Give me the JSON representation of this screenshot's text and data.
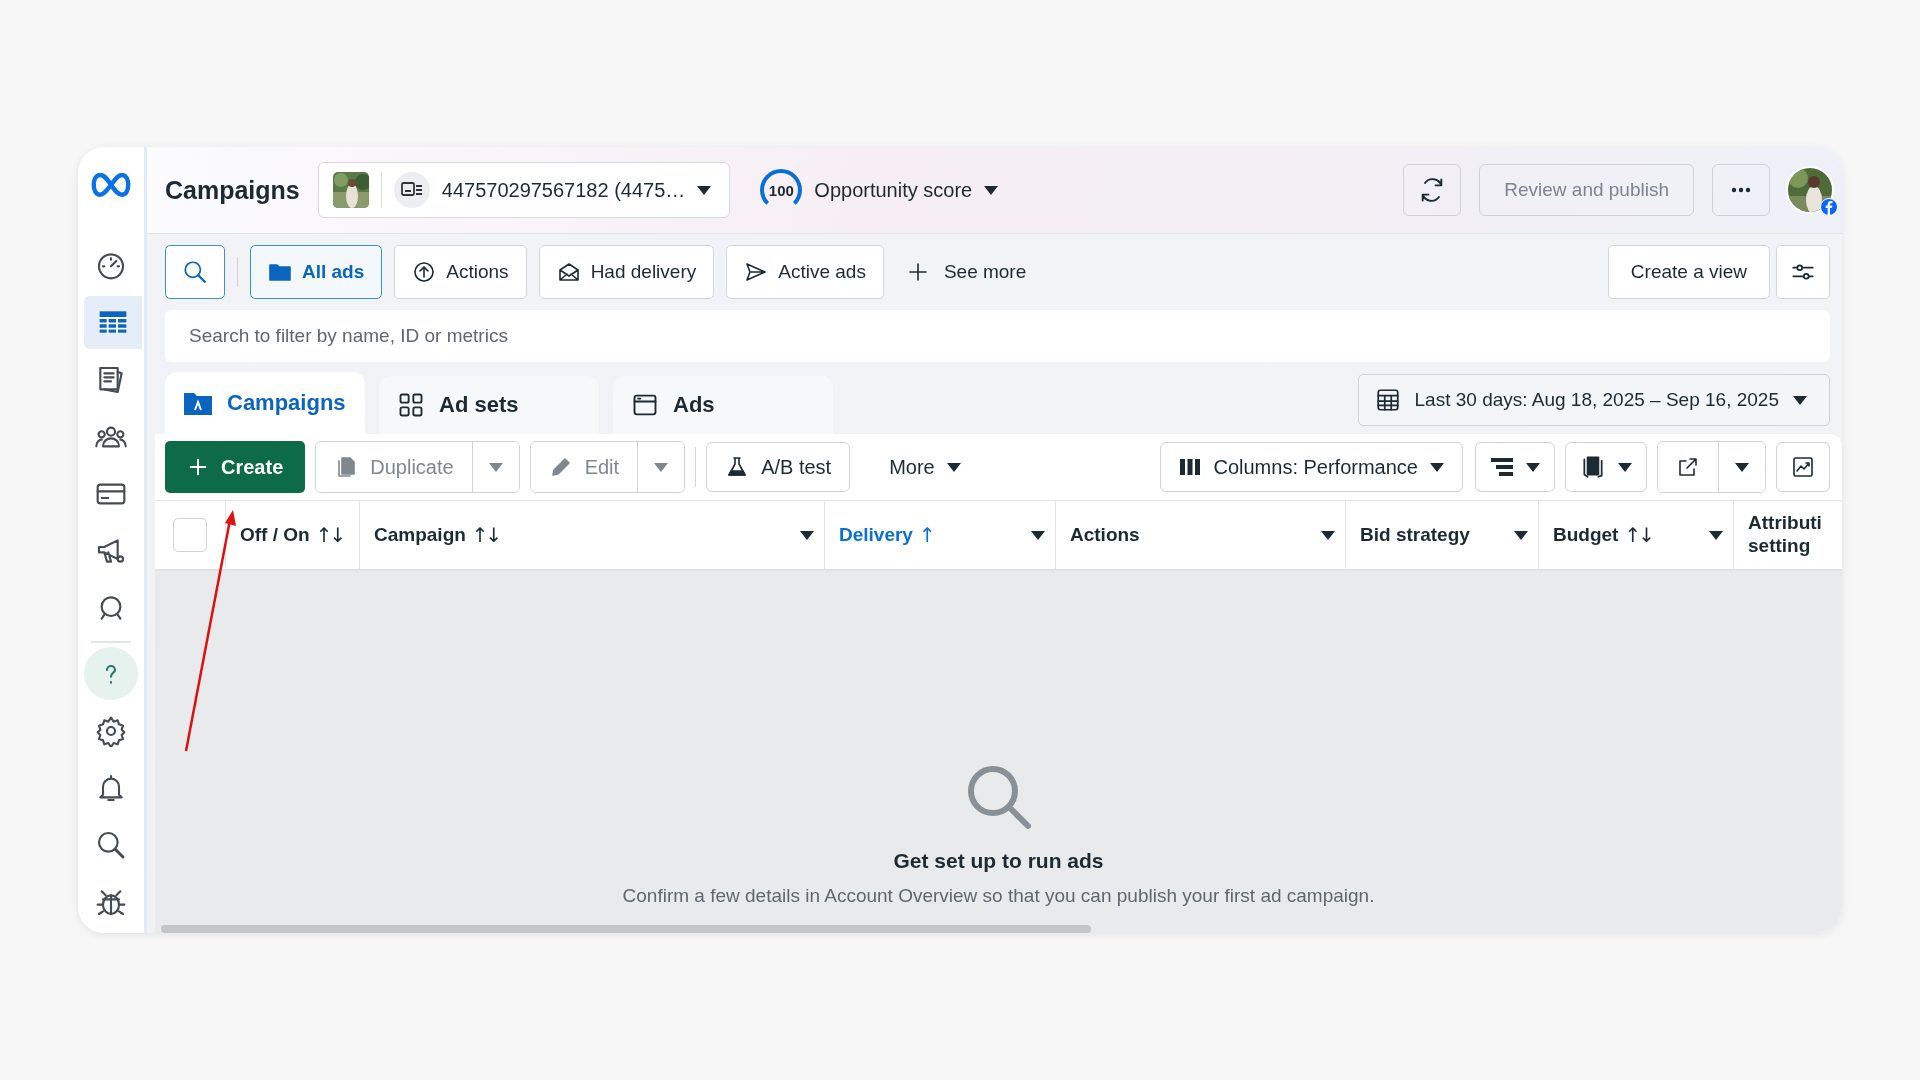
{
  "sidebar": {
    "items": [
      {
        "kind": "gauge",
        "selected": false
      },
      {
        "kind": "table",
        "selected": true
      },
      {
        "kind": "pages",
        "selected": false
      },
      {
        "kind": "people",
        "selected": false
      },
      {
        "kind": "card",
        "selected": false
      },
      {
        "kind": "megaphone",
        "selected": false
      },
      {
        "kind": "chat",
        "selected": false
      },
      {
        "kind": "help",
        "selected": false
      },
      {
        "kind": "gear",
        "selected": false
      },
      {
        "kind": "bell",
        "selected": false
      },
      {
        "kind": "search",
        "selected": false
      },
      {
        "kind": "bug",
        "selected": false
      }
    ]
  },
  "header": {
    "title": "Campaigns",
    "account": "447570297567182 (4475…",
    "score": "100",
    "score_label": "Opportunity score",
    "publish": {
      "label": "Review and publish",
      "disabled": true
    }
  },
  "filters": {
    "chips": [
      {
        "label": "All ads",
        "kind": "folder",
        "selected": true
      },
      {
        "label": "Actions",
        "kind": "upload",
        "selected": false
      },
      {
        "label": "Had delivery",
        "kind": "envelope",
        "selected": false
      },
      {
        "label": "Active ads",
        "kind": "send",
        "selected": false
      }
    ],
    "see_more": "See more",
    "create_view": "Create a view"
  },
  "search": {
    "placeholder": "Search to filter by name, ID or metrics"
  },
  "level_tabs": [
    {
      "label": "Campaigns",
      "kind": "folder",
      "selected": true
    },
    {
      "label": "Ad sets",
      "kind": "grid",
      "selected": false
    },
    {
      "label": "Ads",
      "kind": "window",
      "selected": false
    }
  ],
  "date_range": "Last 30 days: Aug 18, 2025 – Sep 16, 2025",
  "toolbar": {
    "create": "Create",
    "duplicate": {
      "label": "Duplicate",
      "disabled": true
    },
    "edit": {
      "label": "Edit",
      "disabled": true
    },
    "ab_test": "A/B test",
    "more": "More",
    "columns": "Columns: Performance"
  },
  "table": {
    "select_all": {
      "checked": false
    },
    "columns": [
      {
        "label": "Off / On",
        "sort": "↑↓",
        "active": false
      },
      {
        "label": "Campaign",
        "sort": "↑↓",
        "active": false
      },
      {
        "label": "Delivery",
        "sort": "↑",
        "active": true
      },
      {
        "label": "Actions",
        "active": false
      },
      {
        "label": "Bid strategy",
        "active": false
      },
      {
        "label": "Budget",
        "sort": "↑↓",
        "active": false
      },
      {
        "label": "Attributi setting",
        "active": false
      }
    ]
  },
  "empty_state": {
    "title": "Get set up to run ads",
    "message": "Confirm a few details in Account Overview so that you can publish your first ad campaign."
  }
}
